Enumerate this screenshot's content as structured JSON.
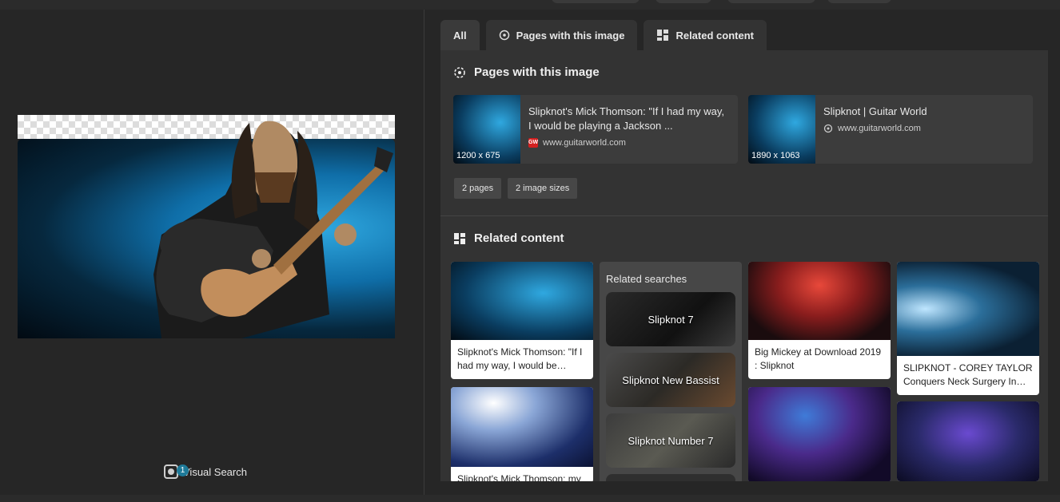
{
  "left": {
    "visual_search_label": "Visual Search",
    "visual_search_badge": "1"
  },
  "tabs": [
    {
      "label": "All",
      "icon": ""
    },
    {
      "label": "Pages with this image",
      "icon": "pages-icon"
    },
    {
      "label": "Related content",
      "icon": "grid-icon"
    }
  ],
  "pages_section": {
    "title": "Pages with this image",
    "cards": [
      {
        "dims": "1200 x 675",
        "title": "Slipknot's Mick Thomson: \"If I had my way, I would be playing a Jackson ...",
        "url": "www.guitarworld.com",
        "favicon": "GW"
      },
      {
        "dims": "1890 x 1063",
        "title": "Slipknot | Guitar World",
        "url": "www.guitarworld.com",
        "favicon": "globe-icon"
      }
    ],
    "chips": [
      "2 pages",
      "2 image sizes"
    ]
  },
  "related_section": {
    "title": "Related content",
    "cards": [
      {
        "caption": "Slipknot's Mick Thomson: \"If I had my way, I would be…"
      },
      {
        "caption": "Slipknot's Mick Thomson: my"
      },
      {
        "caption": "Big Mickey at Download 2019 : Slipknot"
      },
      {
        "caption": "SLIPKNOT - COREY TAYLOR Conquers Neck Surgery In…"
      }
    ],
    "related_searches": {
      "title": "Related searches",
      "items": [
        "Slipknot 7",
        "Slipknot New Bassist",
        "Slipknot Number 7"
      ]
    }
  },
  "colors": {
    "accent": "#1e7a99",
    "panel": "#333333",
    "background": "#262626"
  }
}
